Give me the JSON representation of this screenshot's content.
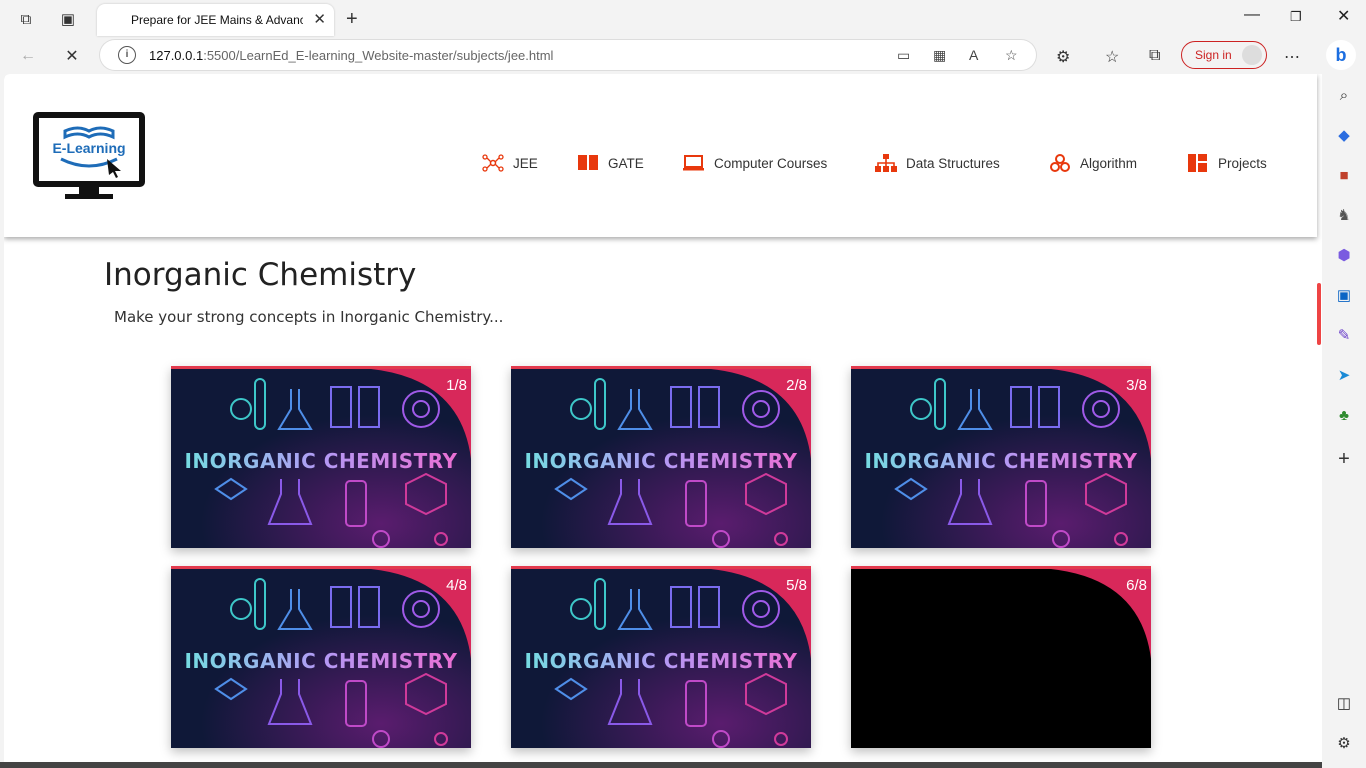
{
  "browser": {
    "tab_title": "Prepare for JEE Mains & Advanced",
    "url_host": "127.0.0.1",
    "url_rest": ":5500/LearnEd_E-learning_Website-master/subjects/jee.html",
    "signin_label": "Sign in",
    "bing_label": "b"
  },
  "site": {
    "logo_text": "E-Learning",
    "nav": [
      {
        "label": "JEE",
        "icon": "atom-icon"
      },
      {
        "label": "GATE",
        "icon": "book-icon"
      },
      {
        "label": "Computer Courses",
        "icon": "laptop-icon"
      },
      {
        "label": "Data Structures",
        "icon": "sitemap-icon"
      },
      {
        "label": "Algorithm",
        "icon": "cubes-icon"
      },
      {
        "label": "Projects",
        "icon": "layout-icon"
      }
    ]
  },
  "content": {
    "title": "Inorganic Chemistry",
    "subtitle": "Make your strong concepts in Inorganic Chemistry...",
    "cards": [
      {
        "counter": "1/8",
        "image_text": "INORGANIC CHEMISTRY"
      },
      {
        "counter": "2/8",
        "image_text": "INORGANIC CHEMISTRY"
      },
      {
        "counter": "3/8",
        "image_text": "INORGANIC CHEMISTRY"
      },
      {
        "counter": "4/8",
        "image_text": "INORGANIC CHEMISTRY"
      },
      {
        "counter": "5/8",
        "image_text": "INORGANIC CHEMISTRY"
      },
      {
        "counter": "6/8",
        "image_text": ""
      }
    ]
  },
  "colors": {
    "accent": "#e23a4e",
    "nav_icon": "#e8380d",
    "card_bg": "#111a3a"
  }
}
